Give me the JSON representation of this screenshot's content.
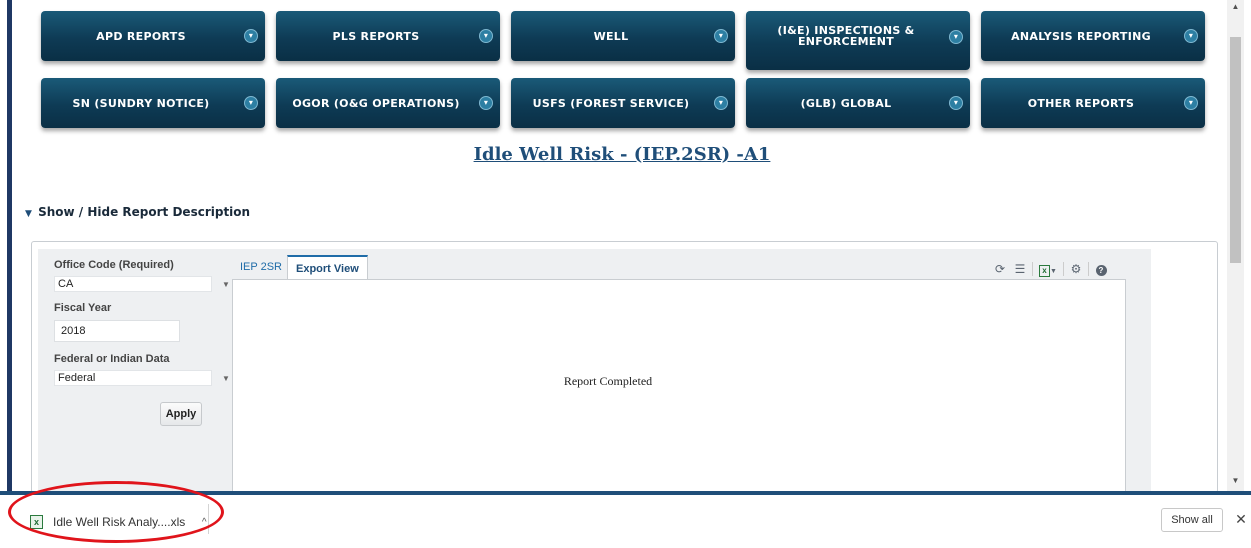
{
  "nav": {
    "row1": [
      {
        "label": "APD REPORTS",
        "name": "nav-apd-reports"
      },
      {
        "label": "PLS REPORTS",
        "name": "nav-pls-reports"
      },
      {
        "label": "WELL",
        "name": "nav-well"
      },
      {
        "label": "(I&E) INSPECTIONS & ENFORCEMENT",
        "name": "nav-inspections-enforcement"
      },
      {
        "label": "ANALYSIS REPORTING",
        "name": "nav-analysis-reporting"
      }
    ],
    "row2": [
      {
        "label": "SN (SUNDRY NOTICE)",
        "name": "nav-sundry-notice"
      },
      {
        "label": "OGOR (O&G OPERATIONS)",
        "name": "nav-ogor"
      },
      {
        "label": "USFS (FOREST SERVICE)",
        "name": "nav-usfs"
      },
      {
        "label": "(GLB) GLOBAL",
        "name": "nav-global"
      },
      {
        "label": "OTHER REPORTS",
        "name": "nav-other-reports"
      }
    ]
  },
  "report": {
    "title": "Idle Well Risk - (IEP.2SR) -A1",
    "desc_toggle": "Show / Hide Report Description",
    "status": "Report Completed"
  },
  "params": {
    "office_label": "Office Code (Required)",
    "office_value": "CA",
    "fiscal_label": "Fiscal Year",
    "fiscal_value": "2018",
    "data_label": "Federal or Indian Data",
    "data_value": "Federal",
    "apply_label": "Apply"
  },
  "tabs": [
    {
      "label": "IEP 2SR",
      "active": false
    },
    {
      "label": "Export View",
      "active": true
    }
  ],
  "toolbar_icons": [
    "refresh-icon",
    "list-icon",
    "excel-export-icon",
    "settings-icon",
    "help-icon"
  ],
  "download": {
    "file_label": "Idle Well Risk Analy....xls",
    "show_all": "Show all"
  },
  "colors": {
    "nav_button": "#0e3b55",
    "title": "#1f4e79",
    "highlight": "#e0141b"
  }
}
